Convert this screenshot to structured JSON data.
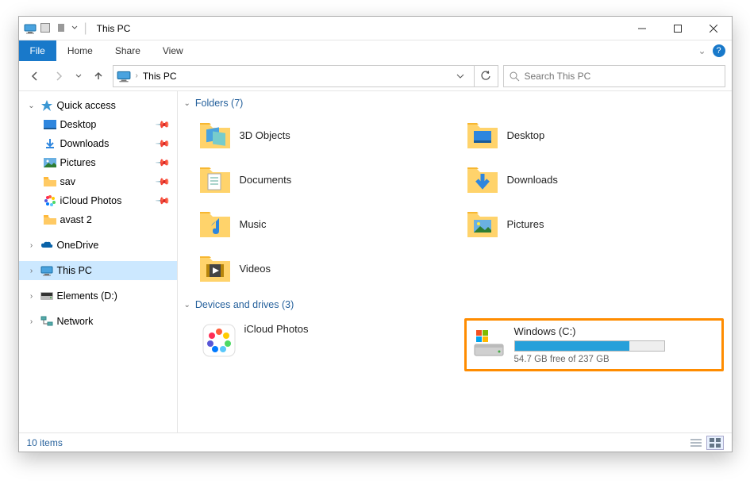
{
  "titlebar": {
    "title": "This PC"
  },
  "ribbon": {
    "file": "File",
    "tabs": [
      "Home",
      "Share",
      "View"
    ]
  },
  "address": {
    "crumb": "This PC"
  },
  "search": {
    "placeholder": "Search This PC"
  },
  "nav": {
    "quick_access": "Quick access",
    "items": [
      {
        "label": "Desktop"
      },
      {
        "label": "Downloads"
      },
      {
        "label": "Pictures"
      },
      {
        "label": "sav"
      },
      {
        "label": "iCloud Photos"
      },
      {
        "label": "avast 2"
      }
    ],
    "onedrive": "OneDrive",
    "this_pc": "This PC",
    "elements": "Elements (D:)",
    "network": "Network"
  },
  "sections": {
    "folders": {
      "title": "Folders (7)"
    },
    "drives": {
      "title": "Devices and drives (3)"
    }
  },
  "folders": [
    {
      "name": "3D Objects"
    },
    {
      "name": "Desktop"
    },
    {
      "name": "Documents"
    },
    {
      "name": "Downloads"
    },
    {
      "name": "Music"
    },
    {
      "name": "Pictures"
    },
    {
      "name": "Videos"
    }
  ],
  "drives": [
    {
      "name": "iCloud Photos",
      "type": "app"
    },
    {
      "name": "Windows (C:)",
      "type": "disk",
      "free_gb": 54.7,
      "total_gb": 237,
      "subtext": "54.7 GB free of 237 GB",
      "fill_pct": 77
    }
  ],
  "statusbar": {
    "count": "10 items"
  }
}
